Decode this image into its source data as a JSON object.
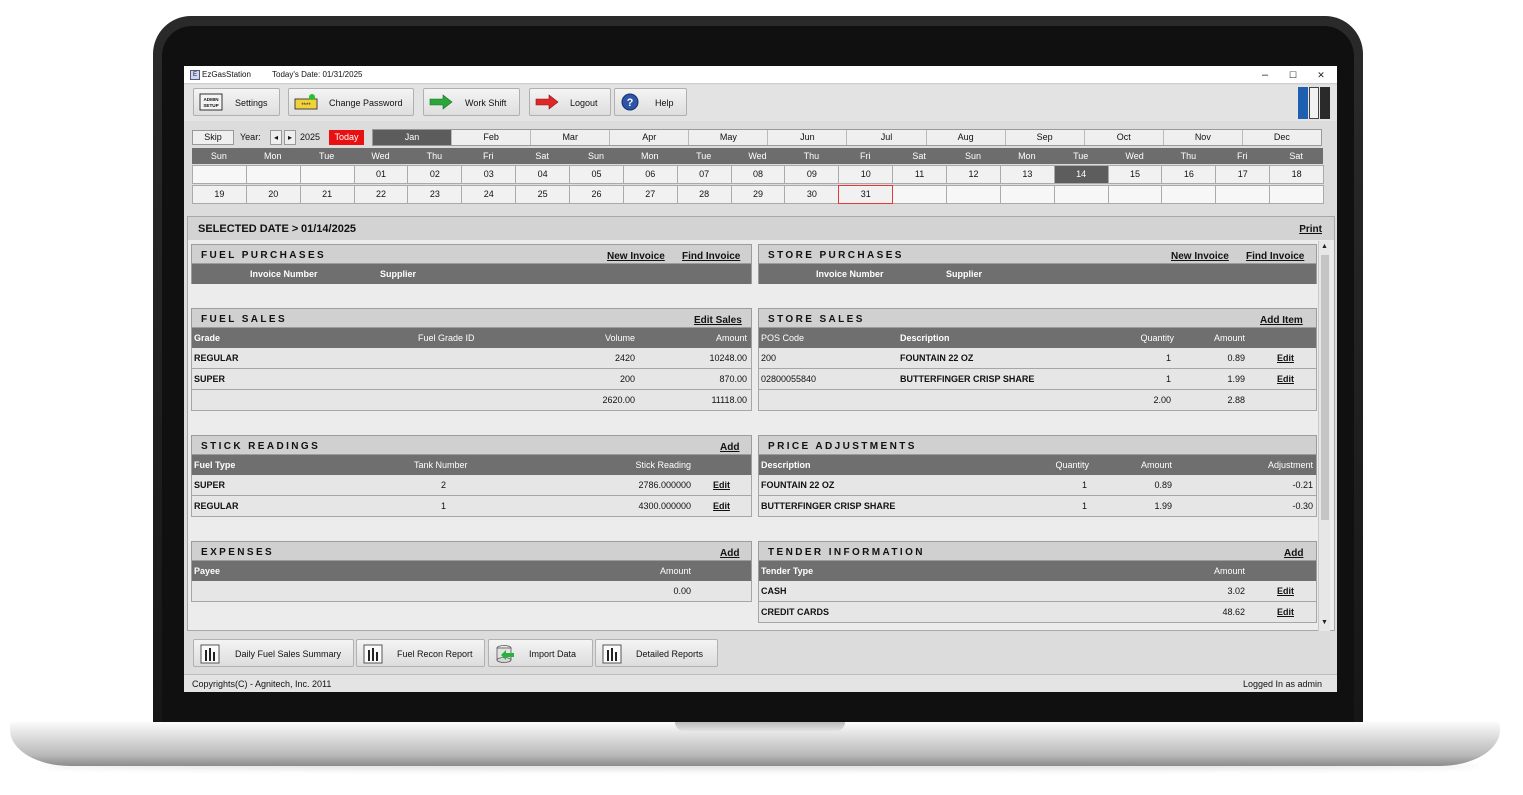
{
  "window": {
    "app_title": "EzGasStation",
    "today_date_text": "Today's Date: 01/31/2025",
    "minimize": "–",
    "maximize": "☐",
    "close": "✕"
  },
  "toolbar": {
    "settings": "Settings",
    "change_password": "Change Password",
    "work_shift": "Work Shift",
    "logout": "Logout",
    "help": "Help",
    "admin_icon_text": "ADMIN SETUP"
  },
  "calendar": {
    "skip": "Skip",
    "year_label": "Year:",
    "year_prev": "◂",
    "year_next": "▸",
    "year": "2025",
    "today": "Today",
    "months": [
      "Jan",
      "Feb",
      "Mar",
      "Apr",
      "May",
      "Jun",
      "Jul",
      "Aug",
      "Sep",
      "Oct",
      "Nov",
      "Dec"
    ],
    "selected_month": "Jan",
    "weekdays": [
      "Sun",
      "Mon",
      "Tue",
      "Wed",
      "Thu",
      "Fri",
      "Sat",
      "Sun",
      "Mon",
      "Tue",
      "Wed",
      "Thu",
      "Fri",
      "Sat",
      "Sun",
      "Mon",
      "Tue",
      "Wed",
      "Thu",
      "Fri",
      "Sat"
    ],
    "week1": [
      "",
      "",
      "",
      "01",
      "02",
      "03",
      "04",
      "05",
      "06",
      "07",
      "08",
      "09",
      "10",
      "11",
      "12",
      "13",
      "14",
      "15",
      "16",
      "17",
      "18"
    ],
    "week2": [
      "19",
      "20",
      "21",
      "22",
      "23",
      "24",
      "25",
      "26",
      "27",
      "28",
      "29",
      "30",
      "31",
      "",
      "",
      "",
      "",
      "",
      "",
      "",
      ""
    ],
    "selected_day": "14",
    "today_day": "31"
  },
  "selected": {
    "label": "SELECTED DATE >",
    "date": "01/14/2025",
    "print": "Print"
  },
  "fuel_purchases": {
    "title": "FUEL PURCHASES",
    "new_invoice": "New Invoice",
    "find_invoice": "Find Invoice",
    "col_invoice": "Invoice Number",
    "col_supplier": "Supplier"
  },
  "store_purchases": {
    "title": "STORE PURCHASES",
    "new_invoice": "New Invoice",
    "find_invoice": "Find Invoice",
    "col_invoice": "Invoice Number",
    "col_supplier": "Supplier"
  },
  "fuel_sales": {
    "title": "FUEL SALES",
    "edit_sales": "Edit Sales",
    "cols": {
      "grade": "Grade",
      "fuel_grade_id": "Fuel Grade ID",
      "volume": "Volume",
      "amount": "Amount"
    },
    "rows": [
      {
        "grade": "REGULAR",
        "volume": "2420",
        "amount": "10248.00"
      },
      {
        "grade": "SUPER",
        "volume": "200",
        "amount": "870.00"
      }
    ],
    "total": {
      "volume": "2620.00",
      "amount": "11118.00"
    }
  },
  "store_sales": {
    "title": "STORE SALES",
    "add_item": "Add Item",
    "cols": {
      "pos_code": "POS Code",
      "description": "Description",
      "quantity": "Quantity",
      "amount": "Amount"
    },
    "rows": [
      {
        "pos_code": "200",
        "description": "FOUNTAIN 22 OZ",
        "quantity": "1",
        "amount": "0.89",
        "edit": "Edit"
      },
      {
        "pos_code": "02800055840",
        "description": "BUTTERFINGER CRISP SHARE",
        "quantity": "1",
        "amount": "1.99",
        "edit": "Edit"
      }
    ],
    "total": {
      "quantity": "2.00",
      "amount": "2.88"
    }
  },
  "stick_readings": {
    "title": "STICK READINGS",
    "add": "Add",
    "cols": {
      "fuel_type": "Fuel Type",
      "tank_number": "Tank Number",
      "stick_reading": "Stick Reading"
    },
    "rows": [
      {
        "fuel_type": "SUPER",
        "tank_number": "2",
        "stick_reading": "2786.000000",
        "edit": "Edit"
      },
      {
        "fuel_type": "REGULAR",
        "tank_number": "1",
        "stick_reading": "4300.000000",
        "edit": "Edit"
      }
    ]
  },
  "price_adjustments": {
    "title": "PRICE ADJUSTMENTS",
    "cols": {
      "description": "Description",
      "quantity": "Quantity",
      "amount": "Amount",
      "adjustment": "Adjustment"
    },
    "rows": [
      {
        "description": "FOUNTAIN 22 OZ",
        "quantity": "1",
        "amount": "0.89",
        "adjustment": "-0.21"
      },
      {
        "description": "BUTTERFINGER CRISP SHARE",
        "quantity": "1",
        "amount": "1.99",
        "adjustment": "-0.30"
      }
    ]
  },
  "expenses": {
    "title": "EXPENSES",
    "add": "Add",
    "cols": {
      "payee": "Payee",
      "amount": "Amount"
    },
    "total": "0.00"
  },
  "tender": {
    "title": "TENDER INFORMATION",
    "add": "Add",
    "cols": {
      "tender_type": "Tender Type",
      "amount": "Amount"
    },
    "rows": [
      {
        "tender_type": "CASH",
        "amount": "3.02",
        "edit": "Edit"
      },
      {
        "tender_type": "CREDIT CARDS",
        "amount": "48.62",
        "edit": "Edit"
      }
    ]
  },
  "bottom": {
    "daily_fuel": "Daily Fuel Sales Summary",
    "fuel_recon": "Fuel Recon Report",
    "import_data": "Import Data",
    "detailed_reports": "Detailed Reports"
  },
  "status": {
    "copyright": "Copyrights(C) - Agnitech, Inc. 2011",
    "logged_in": "Logged In as admin"
  },
  "colors": {
    "today_red": "#e81010",
    "header_gray": "#6f6f6f",
    "selected_day": "#5d5d5d"
  },
  "icons": [
    "admin-setup-icon",
    "change-password-icon",
    "work-shift-icon",
    "logout-icon",
    "help-icon",
    "report-icon",
    "import-data-icon"
  ]
}
